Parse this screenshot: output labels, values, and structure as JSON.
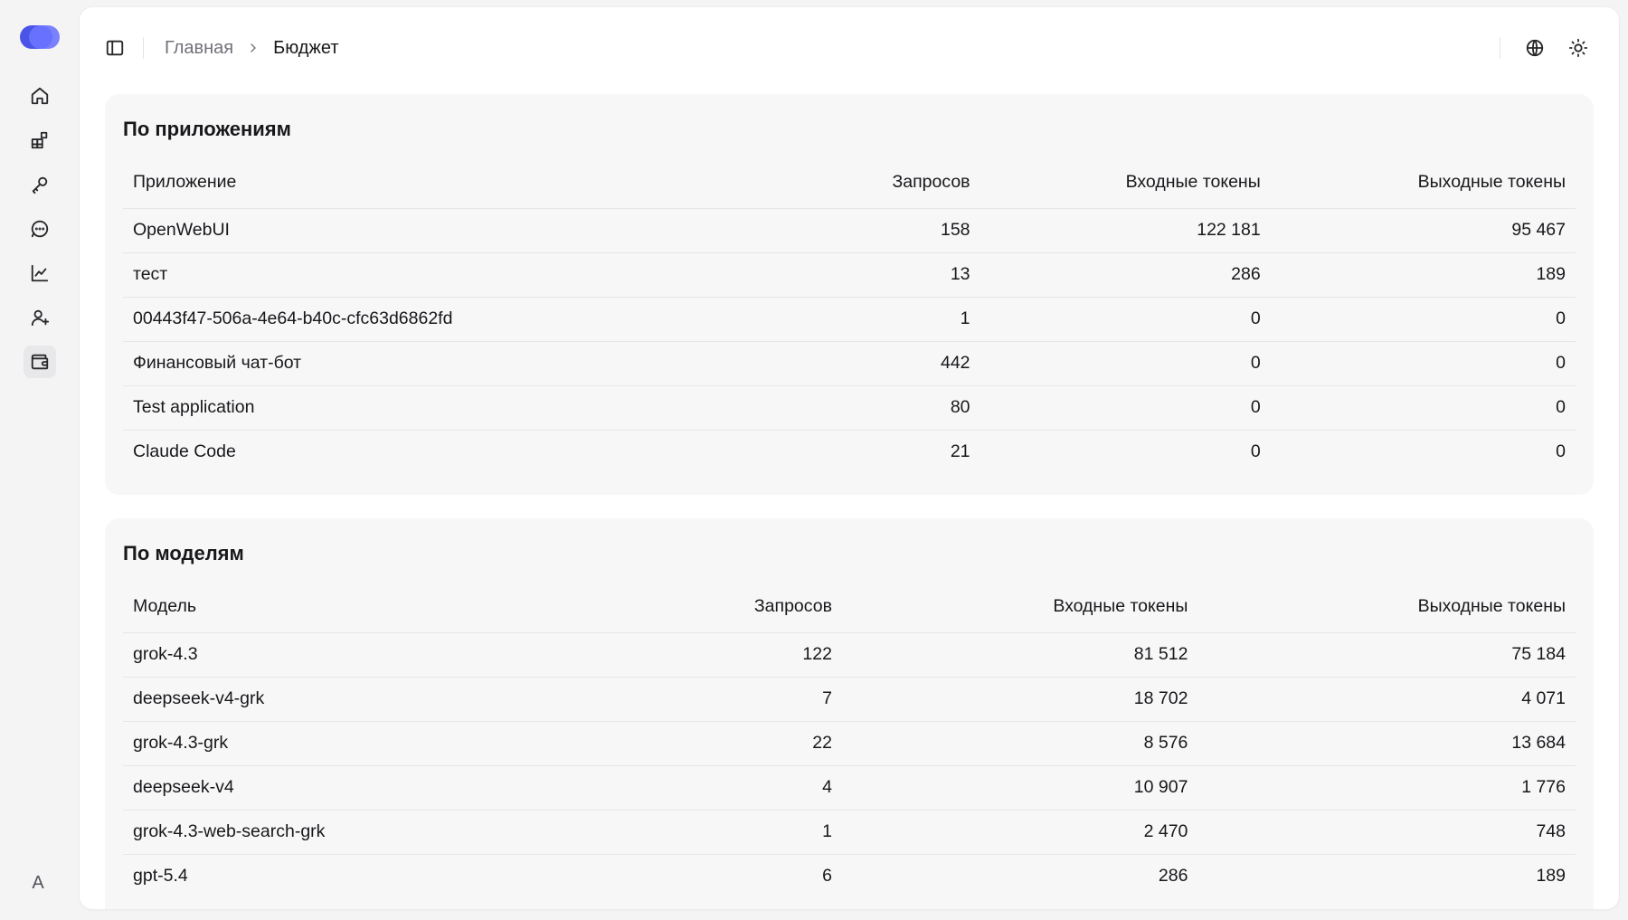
{
  "breadcrumb": {
    "home": "Главная",
    "current": "Бюджет"
  },
  "user": {
    "avatar_letter": "A"
  },
  "nav": [
    {
      "name": "home-icon",
      "active": false
    },
    {
      "name": "apps-icon",
      "active": false
    },
    {
      "name": "key-icon",
      "active": false
    },
    {
      "name": "chat-icon",
      "active": false
    },
    {
      "name": "chart-icon",
      "active": false
    },
    {
      "name": "user-add-icon",
      "active": false
    },
    {
      "name": "wallet-icon",
      "active": true
    }
  ],
  "by_apps": {
    "title": "По приложениям",
    "columns": [
      "Приложение",
      "Запросов",
      "Входные токены",
      "Выходные токены"
    ],
    "rows": [
      [
        "OpenWebUI",
        "158",
        "122 181",
        "95 467"
      ],
      [
        "тест",
        "13",
        "286",
        "189"
      ],
      [
        "00443f47-506a-4e64-b40c-cfc63d6862fd",
        "1",
        "0",
        "0"
      ],
      [
        "Финансовый чат-бот",
        "442",
        "0",
        "0"
      ],
      [
        "Test application",
        "80",
        "0",
        "0"
      ],
      [
        "Claude Code",
        "21",
        "0",
        "0"
      ]
    ]
  },
  "by_models": {
    "title": "По моделям",
    "columns": [
      "Модель",
      "Запросов",
      "Входные токены",
      "Выходные токены"
    ],
    "rows": [
      [
        "grok-4.3",
        "122",
        "81 512",
        "75 184"
      ],
      [
        "deepseek-v4-grk",
        "7",
        "18 702",
        "4 071"
      ],
      [
        "grok-4.3-grk",
        "22",
        "8 576",
        "13 684"
      ],
      [
        "deepseek-v4",
        "4",
        "10 907",
        "1 776"
      ],
      [
        "grok-4.3-web-search-grk",
        "1",
        "2 470",
        "748"
      ],
      [
        "gpt-5.4",
        "6",
        "286",
        "189"
      ]
    ]
  },
  "colors": {
    "accent": "#4a55e8",
    "card_bg": "#f7f7f8",
    "page_bg": "#f4f4f5"
  }
}
